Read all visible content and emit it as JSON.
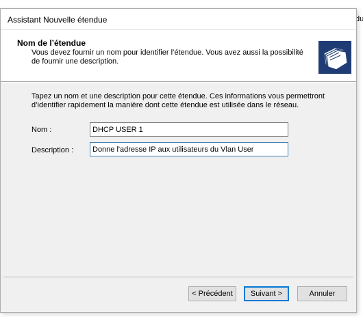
{
  "background": {
    "fragment": "du"
  },
  "dialog": {
    "title": "Assistant Nouvelle étendue",
    "header": {
      "title": "Nom de l’étendue",
      "description": "Vous devez fournir un nom pour identifier l’étendue. Vous avez aussi la possibilité de fournir une description.",
      "icon": "folders-icon"
    },
    "intro": "Tapez un nom et une description pour cette étendue. Ces informations vous permettront d’identifier rapidement la manière dont cette étendue est utilisée dans le réseau.",
    "form": {
      "name_label": "Nom :",
      "name_value": "DHCP USER 1",
      "description_label": "Description :",
      "description_value": "Donne l'adresse IP aux utilisateurs du Vlan User"
    },
    "buttons": {
      "previous": "< Précédent",
      "next": "Suivant >",
      "cancel": "Annuler"
    }
  },
  "colors": {
    "dialog_bg": "#f0f0f0",
    "header_bg": "#ffffff",
    "icon_bg": "#1f3c74",
    "default_button_border": "#0078d7"
  }
}
